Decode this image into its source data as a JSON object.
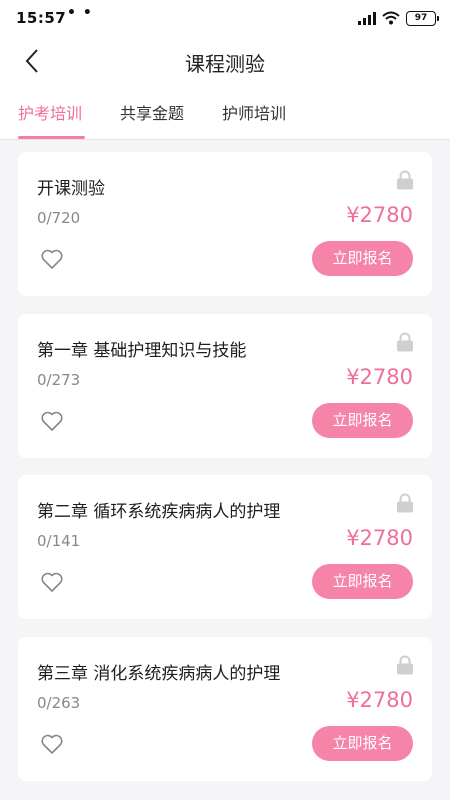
{
  "status_bar": {
    "time": "15:57",
    "dots": "• •",
    "battery": "97",
    "icons": [
      "signal-icon",
      "wifi-icon",
      "battery-icon"
    ]
  },
  "header": {
    "title": "课程测验",
    "back_icon": "back-arrow-icon"
  },
  "tabs": [
    {
      "label": "护考培训",
      "active": true
    },
    {
      "label": "共享金题",
      "active": false
    },
    {
      "label": "护师培训",
      "active": false
    }
  ],
  "courses": [
    {
      "title": "开课测验",
      "progress": "0/720",
      "price": "¥2780",
      "button": "立即报名",
      "locked": true
    },
    {
      "title": "第一章 基础护理知识与技能",
      "progress": "0/273",
      "price": "¥2780",
      "button": "立即报名",
      "locked": true
    },
    {
      "title": "第二章 循环系统疾病病人的护理",
      "progress": "0/141",
      "price": "¥2780",
      "button": "立即报名",
      "locked": true
    },
    {
      "title": "第三章 消化系统疾病病人的护理",
      "progress": "0/263",
      "price": "¥2780",
      "button": "立即报名",
      "locked": true
    }
  ],
  "colors": {
    "accent": "#ef6f98",
    "button": "#f584a8",
    "background": "#f5f5f7"
  }
}
